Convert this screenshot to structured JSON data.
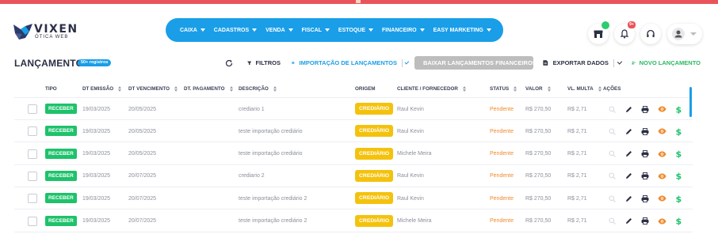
{
  "brand": {
    "name": "VIXEN",
    "tagline": "ÓTICA WEB"
  },
  "nav": [
    {
      "label": "CAIXA"
    },
    {
      "label": "CADASTROS"
    },
    {
      "label": "VENDA"
    },
    {
      "label": "FISCAL"
    },
    {
      "label": "ESTOQUE"
    },
    {
      "label": "FINANCEIRO"
    },
    {
      "label": "EASY MARKETING"
    }
  ],
  "header_icons": {
    "store": {
      "icon": "store-icon",
      "status_color": "#2ecc71"
    },
    "notifications": {
      "icon": "bell-icon",
      "count": "9+",
      "badge_color": "#e9545a"
    },
    "support": {
      "icon": "headset-icon"
    },
    "user": {
      "icon": "user-icon"
    }
  },
  "page": {
    "title": "LANÇAMENTOS",
    "count_badge": "50+ registros"
  },
  "toolbar": {
    "refresh_icon": "refresh-icon",
    "filtros": "FILTROS",
    "importacao": "IMPORTAÇÃO DE LANÇAMENTOS",
    "baixar": "BAIXAR LANÇAMENTOS FINANCEIROS",
    "exportar": "EXPORTAR DADOS",
    "novo": "NOVO LANÇAMENTO"
  },
  "table": {
    "columns": [
      "TIPO",
      "DT EMISSÃO",
      "DT VENCIMENTO",
      "DT. PAGAMENTO",
      "DESCRIÇÃO",
      "ORIGEM",
      "CLIENTE / FORNECEDOR",
      "STATUS",
      "VALOR",
      "VL. MULTA",
      "AÇÕES"
    ],
    "rows": [
      {
        "tipo": "RECEBER",
        "emissao": "19/03/2025",
        "vencimento": "20/05/2025",
        "pagamento": "",
        "descricao": "crediario 1",
        "origem": "CREDIÁRIO",
        "cliente": "Raul Kevin",
        "status": "Pendente",
        "valor": "R$ 270,50",
        "multa": "R$ 2,71"
      },
      {
        "tipo": "RECEBER",
        "emissao": "19/03/2025",
        "vencimento": "20/05/2025",
        "pagamento": "",
        "descricao": "teste importação crediário",
        "origem": "CREDIÁRIO",
        "cliente": "Raul Kevin",
        "status": "Pendente",
        "valor": "R$ 270,50",
        "multa": "R$ 2,71"
      },
      {
        "tipo": "RECEBER",
        "emissao": "19/03/2025",
        "vencimento": "20/05/2025",
        "pagamento": "",
        "descricao": "teste importação crediário",
        "origem": "CREDIÁRIO",
        "cliente": "Michele Meira",
        "status": "Pendente",
        "valor": "R$ 270,50",
        "multa": "R$ 2,71"
      },
      {
        "tipo": "RECEBER",
        "emissao": "19/03/2025",
        "vencimento": "20/07/2025",
        "pagamento": "",
        "descricao": "crediario 2",
        "origem": "CREDIÁRIO",
        "cliente": "Raul Kevin",
        "status": "Pendente",
        "valor": "R$ 270,50",
        "multa": "R$ 2,71"
      },
      {
        "tipo": "RECEBER",
        "emissao": "19/03/2025",
        "vencimento": "20/07/2025",
        "pagamento": "",
        "descricao": "teste importação crediário 2",
        "origem": "CREDIÁRIO",
        "cliente": "Raul Kevin",
        "status": "Pendente",
        "valor": "R$ 270,50",
        "multa": "R$ 2,71"
      },
      {
        "tipo": "RECEBER",
        "emissao": "19/03/2025",
        "vencimento": "20/07/2025",
        "pagamento": "",
        "descricao": "teste importação crediário 2",
        "origem": "CREDIÁRIO",
        "cliente": "Michele Meira",
        "status": "Pendente",
        "valor": "R$ 270,50",
        "multa": "R$ 2,71"
      }
    ],
    "row_actions": [
      "search-icon",
      "pencil-icon",
      "printer-icon",
      "eye-icon",
      "dollar-icon"
    ]
  },
  "colors": {
    "accent": "#1a9ee8",
    "success": "#1ec26b",
    "warning": "#f4c20d",
    "pending": "#f08a2c",
    "danger": "#e9545a"
  }
}
